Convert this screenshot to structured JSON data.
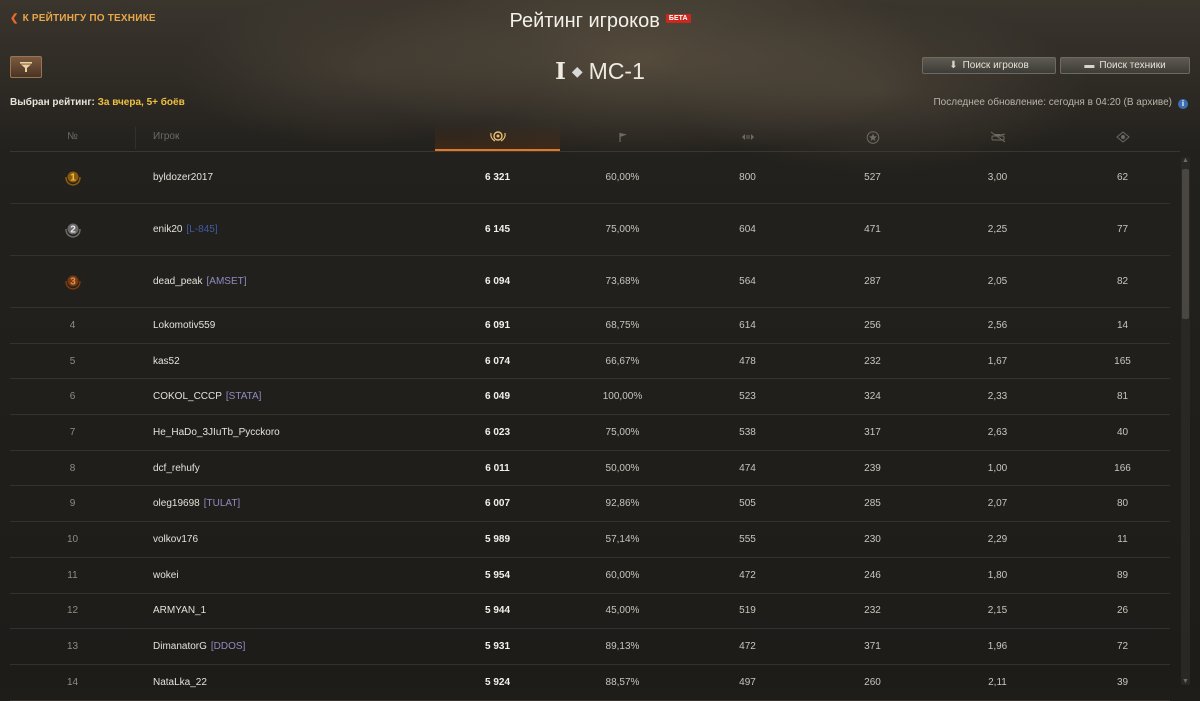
{
  "header": {
    "back_link": "К РЕЙТИНГУ ПО ТЕХНИКЕ",
    "title": "Рейтинг игроков",
    "beta": "БЕТА"
  },
  "tank": {
    "tier": "I",
    "name": "МС-1"
  },
  "buttons": {
    "search_players": "Поиск игроков",
    "search_vehicles": "Поиск техники"
  },
  "selected_rating": {
    "label": "Выбран рейтинг:",
    "value": "За вчера, 5+ боёв"
  },
  "last_update": "Последнее обновление: сегодня в 04:20 (В архиве)",
  "columns": {
    "rank": "№",
    "player": "Игрок"
  },
  "rows": [
    {
      "rank": "1",
      "player": "byldozer2017",
      "clan": "",
      "rating": "6 321",
      "wins": "60,00%",
      "dmg": "800",
      "xp": "527",
      "kills": "3,00",
      "spot": "62",
      "medal": "gold"
    },
    {
      "rank": "2",
      "player": "enik20",
      "clan": "[L-845]",
      "rating": "6 145",
      "wins": "75,00%",
      "dmg": "604",
      "xp": "471",
      "kills": "2,25",
      "spot": "77",
      "medal": "silver"
    },
    {
      "rank": "3",
      "player": "dead_peak",
      "clan": "[AMSET]",
      "rating": "6 094",
      "wins": "73,68%",
      "dmg": "564",
      "xp": "287",
      "kills": "2,05",
      "spot": "82",
      "medal": "bronze"
    },
    {
      "rank": "4",
      "player": "Lokomotiv559",
      "clan": "",
      "rating": "6 091",
      "wins": "68,75%",
      "dmg": "614",
      "xp": "256",
      "kills": "2,56",
      "spot": "14",
      "medal": ""
    },
    {
      "rank": "5",
      "player": "kas52",
      "clan": "",
      "rating": "6 074",
      "wins": "66,67%",
      "dmg": "478",
      "xp": "232",
      "kills": "1,67",
      "spot": "165",
      "medal": ""
    },
    {
      "rank": "6",
      "player": "COKOL_CCCP",
      "clan": "[STATA]",
      "rating": "6 049",
      "wins": "100,00%",
      "dmg": "523",
      "xp": "324",
      "kills": "2,33",
      "spot": "81",
      "medal": ""
    },
    {
      "rank": "7",
      "player": "He_HaDo_3JIuTb_Pycckoro",
      "clan": "",
      "rating": "6 023",
      "wins": "75,00%",
      "dmg": "538",
      "xp": "317",
      "kills": "2,63",
      "spot": "40",
      "medal": ""
    },
    {
      "rank": "8",
      "player": "dcf_rehufy",
      "clan": "",
      "rating": "6 011",
      "wins": "50,00%",
      "dmg": "474",
      "xp": "239",
      "kills": "1,00",
      "spot": "166",
      "medal": ""
    },
    {
      "rank": "9",
      "player": "oleg19698",
      "clan": "[TULAT]",
      "rating": "6 007",
      "wins": "92,86%",
      "dmg": "505",
      "xp": "285",
      "kills": "2,07",
      "spot": "80",
      "medal": ""
    },
    {
      "rank": "10",
      "player": "volkov176",
      "clan": "",
      "rating": "5 989",
      "wins": "57,14%",
      "dmg": "555",
      "xp": "230",
      "kills": "2,29",
      "spot": "11",
      "medal": ""
    },
    {
      "rank": "11",
      "player": "wokei",
      "clan": "",
      "rating": "5 954",
      "wins": "60,00%",
      "dmg": "472",
      "xp": "246",
      "kills": "1,80",
      "spot": "89",
      "medal": ""
    },
    {
      "rank": "12",
      "player": "ARMYAN_1",
      "clan": "",
      "rating": "5 944",
      "wins": "45,00%",
      "dmg": "519",
      "xp": "232",
      "kills": "2,15",
      "spot": "26",
      "medal": ""
    },
    {
      "rank": "13",
      "player": "DimanatorG",
      "clan": "[DDOS]",
      "rating": "5 931",
      "wins": "89,13%",
      "dmg": "472",
      "xp": "371",
      "kills": "1,96",
      "spot": "72",
      "medal": ""
    },
    {
      "rank": "14",
      "player": "NataLka_22",
      "clan": "",
      "rating": "5 924",
      "wins": "88,57%",
      "dmg": "497",
      "xp": "260",
      "kills": "2,11",
      "spot": "39",
      "medal": ""
    }
  ],
  "colors": {
    "accent": "#e0782a",
    "gold": "#f0c040",
    "back_link": "#e8a84a"
  }
}
